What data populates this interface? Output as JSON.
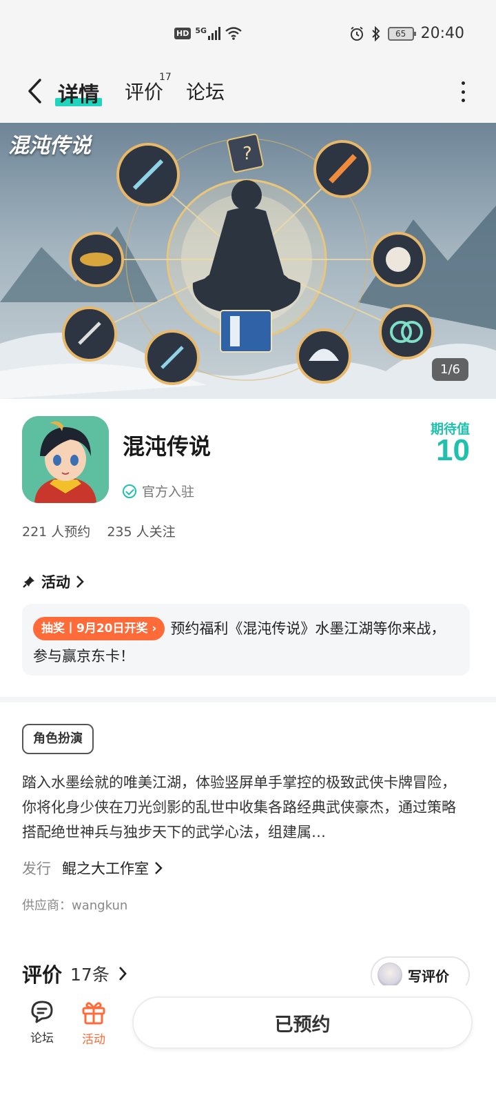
{
  "status_bar": {
    "hd_badge": "HD",
    "network": "5G",
    "battery": "65",
    "time": "20:40"
  },
  "nav": {
    "tabs": [
      {
        "label": "详情",
        "active": true
      },
      {
        "label": "评价",
        "badge": "17"
      },
      {
        "label": "论坛"
      }
    ]
  },
  "banner": {
    "title": "混沌传说",
    "counter": "1/6"
  },
  "game": {
    "name": "混沌传说",
    "official_label": "官方入驻",
    "expect_label": "期待值",
    "expect_value": "10",
    "reservations": "221 人预约",
    "followers": "235 人关注"
  },
  "activity": {
    "heading": "活动",
    "tag": "抽奖丨9月20日开奖",
    "text": "预约福利《混沌传说》水墨江湖等你来战，参与赢京东卡！"
  },
  "details": {
    "genre": "角色扮演",
    "description": "踏入水墨绘就的唯美江湖，体验竖屏单手掌控的极致武侠卡牌冒险，你将化身少侠在刀光剑影的乱世中收集各路经典武侠豪杰，通过策略搭配绝世神兵与独步天下的武学心法，组建属…",
    "publisher_label": "发行",
    "publisher": "鲲之大工作室",
    "supplier": "供应商：wangkun"
  },
  "reviews": {
    "title": "评价",
    "count": "17条",
    "write_label": "写评价"
  },
  "bottom_bar": {
    "forum_label": "论坛",
    "activity_label": "活动",
    "reserved_label": "已预约"
  },
  "colors": {
    "accent": "#1fc1ad",
    "orange": "#ff6a39"
  }
}
